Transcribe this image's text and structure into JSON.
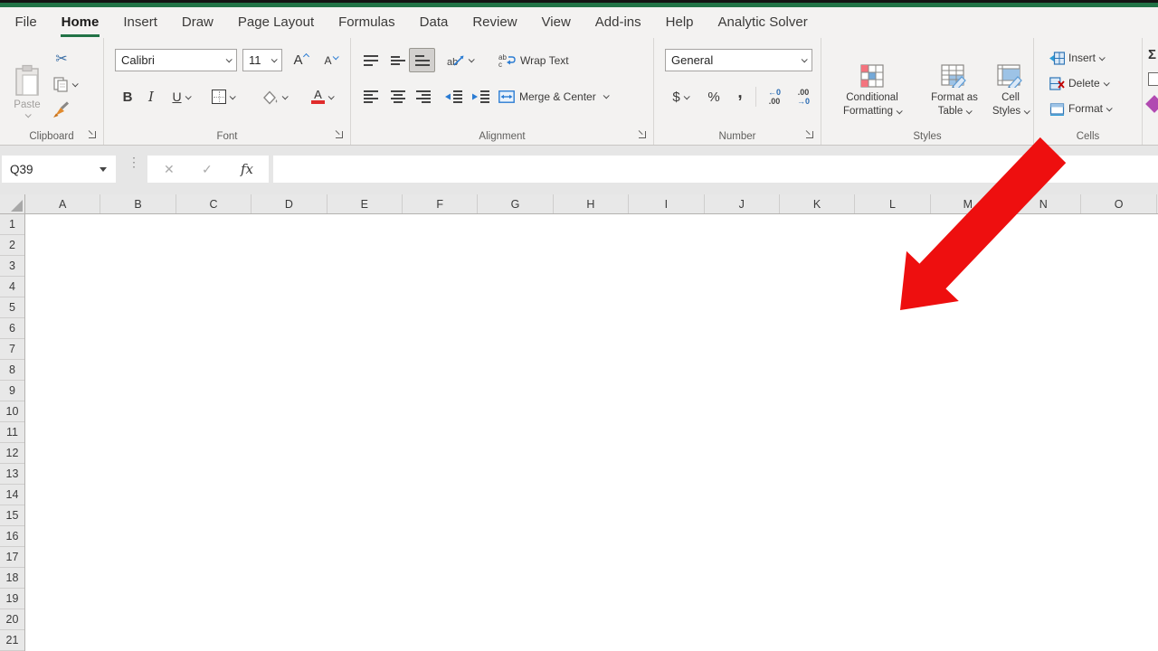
{
  "colors": {
    "accent_green": "#217346",
    "arrow_red": "#ee0f0f"
  },
  "menu": {
    "items": [
      {
        "label": "File"
      },
      {
        "label": "Home",
        "active": true
      },
      {
        "label": "Insert"
      },
      {
        "label": "Draw"
      },
      {
        "label": "Page Layout"
      },
      {
        "label": "Formulas"
      },
      {
        "label": "Data"
      },
      {
        "label": "Review"
      },
      {
        "label": "View"
      },
      {
        "label": "Add-ins"
      },
      {
        "label": "Help"
      },
      {
        "label": "Analytic Solver"
      }
    ]
  },
  "ribbon": {
    "clipboard": {
      "group_label": "Clipboard",
      "paste_label": "Paste"
    },
    "font": {
      "group_label": "Font",
      "family": "Calibri",
      "size": "11",
      "bold": "B",
      "italic": "I",
      "underline": "U"
    },
    "alignment": {
      "group_label": "Alignment",
      "wrap_text": "Wrap Text",
      "merge_center": "Merge & Center"
    },
    "number": {
      "group_label": "Number",
      "format": "General",
      "currency": "$",
      "percent": "%",
      "comma": ",",
      "inc_decimal_top": "←0",
      "inc_decimal_bottom": ".00",
      "dec_decimal_top": ".00",
      "dec_decimal_bottom": "→0"
    },
    "styles": {
      "group_label": "Styles",
      "cf_line1": "Conditional",
      "cf_line2": "Formatting",
      "ft_line1": "Format as",
      "ft_line2": "Table",
      "cs_line1": "Cell",
      "cs_line2": "Styles"
    },
    "cells": {
      "group_label": "Cells",
      "insert": "Insert",
      "delete": "Delete",
      "format": "Format"
    }
  },
  "icons": {
    "cut": "✂",
    "vdots": "⋮",
    "sigma": "Σ",
    "grow_font": "A",
    "shrink_font": "A",
    "font_color": "A",
    "orientation_text": "ab"
  },
  "formula_bar": {
    "name_box": "Q39",
    "cancel": "✕",
    "enter": "✓",
    "fx": "fx",
    "formula": ""
  },
  "grid": {
    "columns": [
      "A",
      "B",
      "C",
      "D",
      "E",
      "F",
      "G",
      "H",
      "I",
      "J",
      "K",
      "L",
      "M",
      "N",
      "O"
    ],
    "rows": [
      "1",
      "2",
      "3",
      "4",
      "5",
      "6",
      "7",
      "8",
      "9",
      "10",
      "11",
      "12",
      "13",
      "14",
      "15",
      "16",
      "17",
      "18",
      "19",
      "20",
      "21"
    ]
  }
}
